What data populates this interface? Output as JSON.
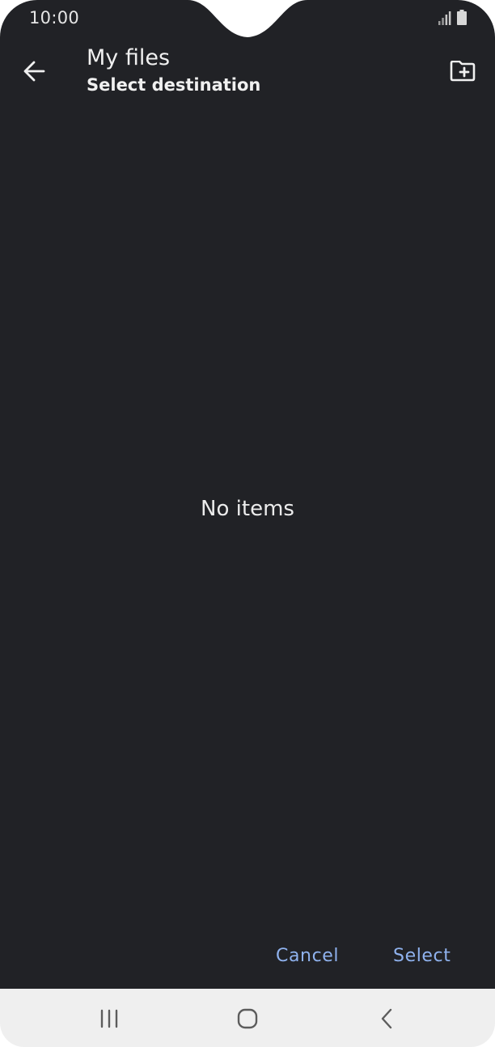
{
  "status_bar": {
    "time": "10:00",
    "icons": [
      "signal-icon",
      "battery-icon"
    ]
  },
  "header": {
    "back_icon": "arrow-left-icon",
    "title": "My files",
    "subtitle": "Select destination",
    "new_folder_icon": "create-folder-icon"
  },
  "content": {
    "empty_message": "No items"
  },
  "actions": {
    "cancel_label": "Cancel",
    "select_label": "Select"
  },
  "nav_bar": {
    "recents_icon": "recents-icon",
    "home_icon": "home-icon",
    "back_icon": "back-chevron-icon"
  },
  "colors": {
    "background": "#212226",
    "text": "#f0f0f0",
    "accent": "#8fb2ee",
    "navbar": "#efefef"
  }
}
